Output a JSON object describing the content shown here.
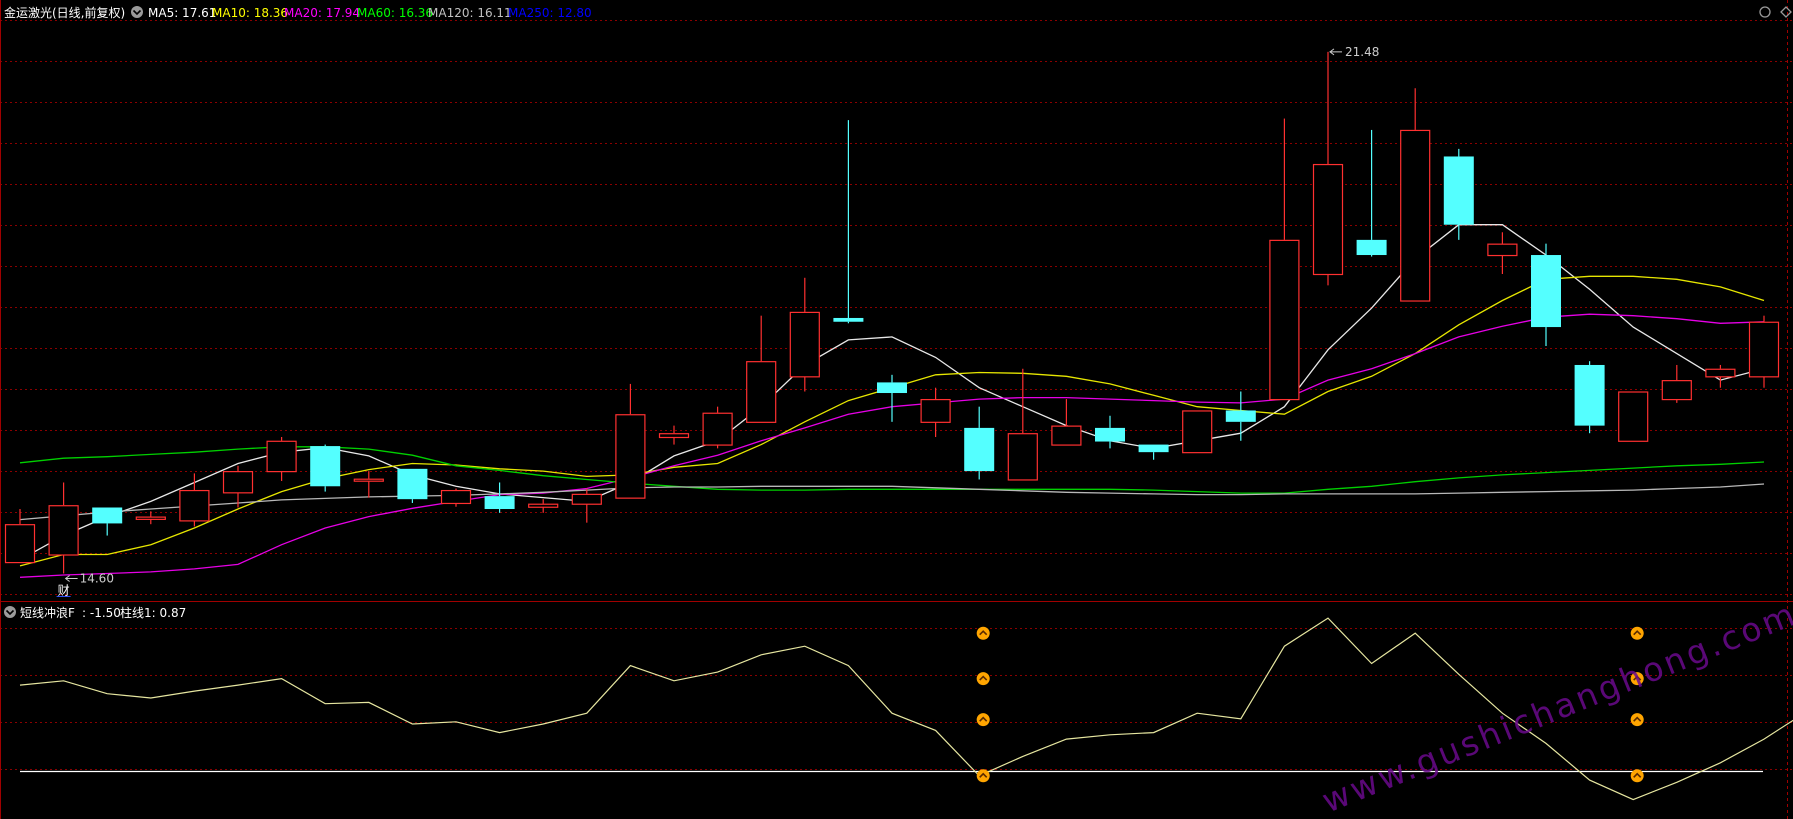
{
  "header": {
    "stock_name": "金运激光(日线,前复权)",
    "ma_items": [
      {
        "label": "MA5: 17.61",
        "color": "#ffffff"
      },
      {
        "label": "MA10: 18.36",
        "color": "#ffff00"
      },
      {
        "label": "MA20: 17.94",
        "color": "#ff00ff"
      },
      {
        "label": "MA60: 16.36",
        "color": "#00ff00"
      },
      {
        "label": "MA120: 16.11",
        "color": "#c0c0c0"
      },
      {
        "label": "MA250: 12.80",
        "color": "#0000ff"
      }
    ]
  },
  "indicator_header": {
    "name": "短线冲浪F",
    "value_label": ": -1.50",
    "bar_label": "柱线1: 0.87"
  },
  "annotations": {
    "high_label": "21.48",
    "low_label": "14.60",
    "finance_marker": "财"
  },
  "watermark": "www.gushichanghong.com",
  "colors": {
    "background": "#000000",
    "up_candle": "#ff3030",
    "down_candle": "#54ffff",
    "grid": "#8b0000",
    "panel_border": "#a00000",
    "ma5": "#e8e8e8",
    "ma10": "#e6e600",
    "ma20": "#e600e6",
    "ma60": "#00d000",
    "ma120": "#b8b8b8",
    "indicator_line": "#e6e6a0",
    "baseline": "#ffffff",
    "signal": "#ffa500",
    "watermark": "#6a0a8c"
  },
  "chart_data": [
    {
      "type": "candlestick",
      "ylim": [
        14.25,
        21.9
      ],
      "candles": [
        {
          "o": 14.75,
          "h": 15.45,
          "l": 14.75,
          "c": 15.25,
          "dir": "up"
        },
        {
          "o": 14.85,
          "h": 15.8,
          "l": 14.6,
          "c": 15.5,
          "dir": "up"
        },
        {
          "o": 15.47,
          "h": 15.47,
          "l": 15.1,
          "c": 15.26,
          "dir": "down"
        },
        {
          "o": 15.32,
          "h": 15.42,
          "l": 15.25,
          "c": 15.35,
          "dir": "up"
        },
        {
          "o": 15.3,
          "h": 15.92,
          "l": 15.22,
          "c": 15.7,
          "dir": "up"
        },
        {
          "o": 15.67,
          "h": 16.02,
          "l": 15.47,
          "c": 15.95,
          "dir": "up"
        },
        {
          "o": 15.95,
          "h": 16.4,
          "l": 15.82,
          "c": 16.35,
          "dir": "up"
        },
        {
          "o": 16.28,
          "h": 16.3,
          "l": 15.68,
          "c": 15.75,
          "dir": "down"
        },
        {
          "o": 15.85,
          "h": 15.95,
          "l": 15.6,
          "c": 15.85,
          "dir": "up"
        },
        {
          "o": 15.98,
          "h": 15.98,
          "l": 15.53,
          "c": 15.58,
          "dir": "down"
        },
        {
          "o": 15.53,
          "h": 15.72,
          "l": 15.48,
          "c": 15.7,
          "dir": "up"
        },
        {
          "o": 15.62,
          "h": 15.8,
          "l": 15.4,
          "c": 15.45,
          "dir": "down"
        },
        {
          "o": 15.48,
          "h": 15.58,
          "l": 15.4,
          "c": 15.52,
          "dir": "up"
        },
        {
          "o": 15.52,
          "h": 15.72,
          "l": 15.27,
          "c": 15.65,
          "dir": "up"
        },
        {
          "o": 15.6,
          "h": 17.1,
          "l": 15.6,
          "c": 16.7,
          "dir": "up"
        },
        {
          "o": 16.4,
          "h": 16.55,
          "l": 16.3,
          "c": 16.45,
          "dir": "up"
        },
        {
          "o": 16.3,
          "h": 16.8,
          "l": 16.25,
          "c": 16.72,
          "dir": "up"
        },
        {
          "o": 16.6,
          "h": 18.0,
          "l": 16.6,
          "c": 17.4,
          "dir": "up"
        },
        {
          "o": 17.2,
          "h": 18.5,
          "l": 17.0,
          "c": 18.05,
          "dir": "up"
        },
        {
          "o": 17.92,
          "h": 20.58,
          "l": 17.9,
          "c": 17.97,
          "dir": "down"
        },
        {
          "o": 17.12,
          "h": 17.22,
          "l": 16.6,
          "c": 16.98,
          "dir": "down"
        },
        {
          "o": 16.6,
          "h": 17.05,
          "l": 16.4,
          "c": 16.9,
          "dir": "up"
        },
        {
          "o": 16.52,
          "h": 16.8,
          "l": 15.84,
          "c": 15.95,
          "dir": "down"
        },
        {
          "o": 15.84,
          "h": 17.3,
          "l": 15.84,
          "c": 16.45,
          "dir": "up"
        },
        {
          "o": 16.3,
          "h": 16.9,
          "l": 16.3,
          "c": 16.55,
          "dir": "up"
        },
        {
          "o": 16.52,
          "h": 16.68,
          "l": 16.25,
          "c": 16.34,
          "dir": "down"
        },
        {
          "o": 16.3,
          "h": 16.3,
          "l": 16.1,
          "c": 16.2,
          "dir": "down"
        },
        {
          "o": 16.2,
          "h": 16.75,
          "l": 16.2,
          "c": 16.75,
          "dir": "up"
        },
        {
          "o": 16.75,
          "h": 17.0,
          "l": 16.35,
          "c": 16.6,
          "dir": "down"
        },
        {
          "o": 16.9,
          "h": 20.6,
          "l": 16.9,
          "c": 19.0,
          "dir": "up"
        },
        {
          "o": 18.55,
          "h": 21.48,
          "l": 18.4,
          "c": 20.0,
          "dir": "up"
        },
        {
          "o": 19.0,
          "h": 20.45,
          "l": 18.78,
          "c": 18.8,
          "dir": "down"
        },
        {
          "o": 18.2,
          "h": 21.0,
          "l": 18.2,
          "c": 20.45,
          "dir": "up"
        },
        {
          "o": 20.1,
          "h": 20.2,
          "l": 19.0,
          "c": 19.2,
          "dir": "down"
        },
        {
          "o": 18.8,
          "h": 19.1,
          "l": 18.55,
          "c": 18.95,
          "dir": "up"
        },
        {
          "o": 18.8,
          "h": 18.95,
          "l": 17.6,
          "c": 17.85,
          "dir": "down"
        },
        {
          "o": 17.35,
          "h": 17.4,
          "l": 16.45,
          "c": 16.55,
          "dir": "down"
        },
        {
          "o": 16.35,
          "h": 17.0,
          "l": 16.35,
          "c": 17.0,
          "dir": "up"
        },
        {
          "o": 16.9,
          "h": 17.35,
          "l": 16.85,
          "c": 17.15,
          "dir": "up"
        },
        {
          "o": 17.2,
          "h": 17.35,
          "l": 17.05,
          "c": 17.3,
          "dir": "up"
        },
        {
          "o": 17.2,
          "h": 18.0,
          "l": 17.05,
          "c": 17.92,
          "dir": "up"
        }
      ],
      "series": [
        {
          "key": "ma5",
          "values": [
            14.78,
            15.1,
            15.35,
            15.55,
            15.8,
            16.05,
            16.2,
            16.26,
            16.15,
            15.9,
            15.75,
            15.65,
            15.6,
            15.55,
            15.8,
            16.15,
            16.35,
            16.8,
            17.35,
            17.68,
            17.72,
            17.45,
            17.05,
            16.8,
            16.55,
            16.35,
            16.25,
            16.35,
            16.45,
            16.8,
            17.55,
            18.1,
            18.75,
            19.2,
            19.2,
            18.8,
            18.35,
            17.85,
            17.5,
            17.15,
            17.3
          ]
        },
        {
          "key": "ma10",
          "values": [
            14.7,
            14.85,
            14.85,
            14.98,
            15.2,
            15.45,
            15.68,
            15.85,
            15.97,
            16.05,
            16.03,
            15.98,
            15.95,
            15.88,
            15.9,
            16.0,
            16.05,
            16.3,
            16.6,
            16.88,
            17.05,
            17.22,
            17.25,
            17.24,
            17.2,
            17.1,
            16.95,
            16.8,
            16.75,
            16.7,
            17.0,
            17.2,
            17.5,
            17.88,
            18.2,
            18.48,
            18.52,
            18.52,
            18.48,
            18.38,
            18.2
          ]
        },
        {
          "key": "ma20",
          "values": [
            14.55,
            14.58,
            14.6,
            14.62,
            14.66,
            14.72,
            14.98,
            15.2,
            15.35,
            15.46,
            15.55,
            15.64,
            15.66,
            15.72,
            15.86,
            16.02,
            16.16,
            16.35,
            16.52,
            16.7,
            16.8,
            16.85,
            16.9,
            16.92,
            16.92,
            16.9,
            16.88,
            16.86,
            16.85,
            16.9,
            17.15,
            17.3,
            17.5,
            17.72,
            17.86,
            17.98,
            18.02,
            18.0,
            17.96,
            17.9,
            17.92
          ]
        },
        {
          "key": "ma60",
          "values": [
            16.06,
            16.12,
            16.14,
            16.17,
            16.2,
            16.24,
            16.27,
            16.27,
            16.24,
            16.16,
            16.02,
            15.96,
            15.89,
            15.84,
            15.79,
            15.75,
            15.71,
            15.7,
            15.7,
            15.71,
            15.71,
            15.71,
            15.71,
            15.71,
            15.71,
            15.71,
            15.7,
            15.68,
            15.66,
            15.66,
            15.71,
            15.75,
            15.81,
            15.86,
            15.9,
            15.93,
            15.96,
            15.99,
            16.02,
            16.04,
            16.07
          ]
        },
        {
          "key": "ma120",
          "values": [
            15.31,
            15.36,
            15.41,
            15.45,
            15.49,
            15.53,
            15.57,
            15.59,
            15.61,
            15.62,
            15.63,
            15.65,
            15.67,
            15.7,
            15.73,
            15.74,
            15.74,
            15.75,
            15.75,
            15.75,
            15.75,
            15.73,
            15.71,
            15.69,
            15.67,
            15.66,
            15.65,
            15.64,
            15.64,
            15.65,
            15.65,
            15.65,
            15.65,
            15.66,
            15.67,
            15.68,
            15.69,
            15.7,
            15.72,
            15.74,
            15.78
          ]
        }
      ]
    },
    {
      "type": "line",
      "name": "短线冲浪F",
      "ylim": [
        -2.6,
        2.4
      ],
      "baseline": -1.5,
      "values": [
        0.5,
        0.6,
        0.3,
        0.2,
        0.36,
        0.5,
        0.65,
        0.07,
        0.1,
        -0.4,
        -0.35,
        -0.6,
        -0.4,
        -0.15,
        0.95,
        0.6,
        0.8,
        1.2,
        1.4,
        0.95,
        -0.15,
        -0.55,
        -1.6,
        -1.15,
        -0.75,
        -0.65,
        -0.6,
        -0.15,
        -0.28,
        1.4,
        2.05,
        1.0,
        1.7,
        0.75,
        -0.15,
        -0.85,
        -1.7,
        -2.15,
        -1.75,
        -1.3,
        -0.75,
        -0.1
      ],
      "signals": [
        {
          "index": 22,
          "rows": [
            1.7,
            0.65,
            -0.3,
            -1.6
          ]
        },
        {
          "index": 37,
          "rows": [
            1.7,
            0.65,
            -0.3,
            -1.6
          ]
        }
      ]
    }
  ]
}
